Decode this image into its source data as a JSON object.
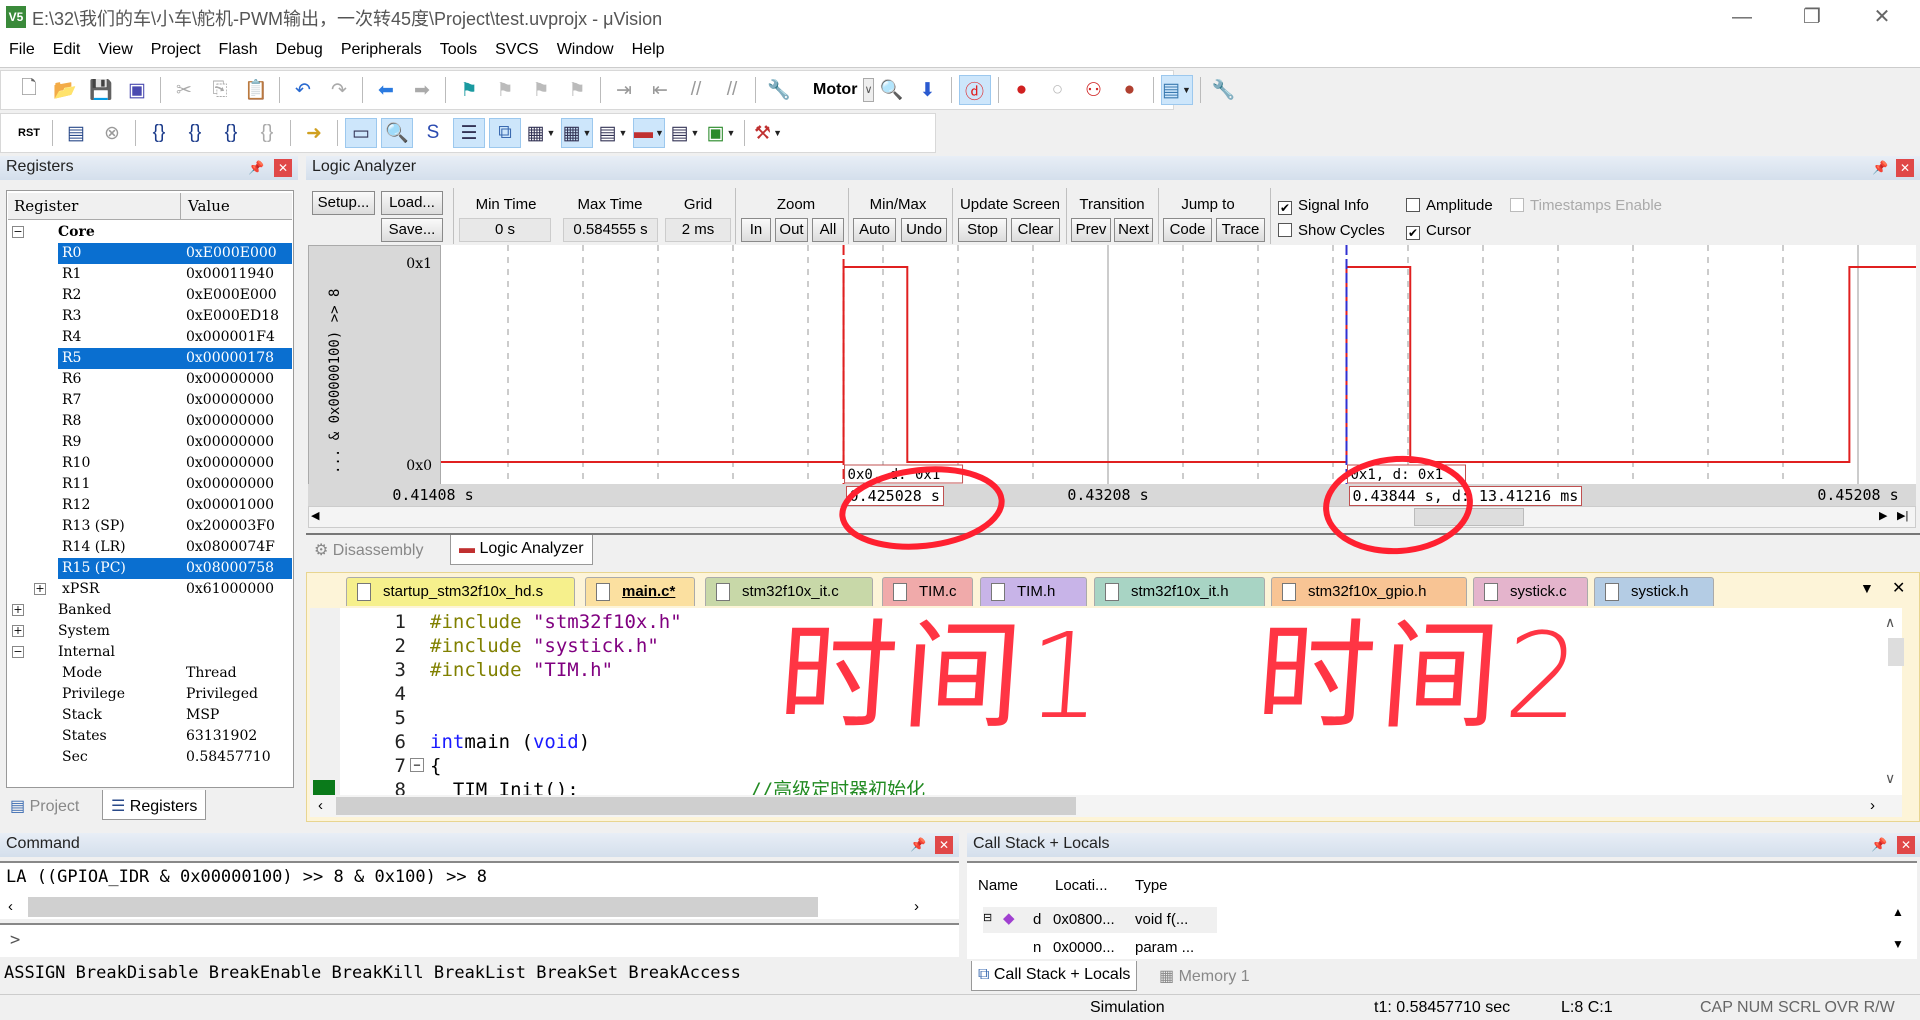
{
  "window": {
    "title": "E:\\32\\我们的车\\小车\\舵机-PWM输出，一次转45度\\Project\\test.uvprojx - μVision",
    "app_icon": "V5",
    "controls": [
      "—",
      "❐",
      "✕"
    ]
  },
  "menu": [
    "File",
    "Edit",
    "View",
    "Project",
    "Flash",
    "Debug",
    "Peripherals",
    "Tools",
    "SVCS",
    "Window",
    "Help"
  ],
  "toolbar1": {
    "left_icons": [
      {
        "name": "new-file",
        "glyph": "🗋",
        "color": "#666"
      },
      {
        "name": "open-file",
        "glyph": "📂",
        "color": "#c98a1a"
      },
      {
        "name": "save",
        "glyph": "💾",
        "color": "#2a4ea0"
      },
      {
        "name": "save-all",
        "glyph": "▣",
        "color": "#4a4ab0"
      },
      {
        "sep": true
      },
      {
        "name": "cut",
        "glyph": "✂",
        "color": "#aaa"
      },
      {
        "name": "copy",
        "glyph": "⎘",
        "color": "#aaa"
      },
      {
        "name": "paste",
        "glyph": "📋",
        "color": "#b08a30"
      },
      {
        "sep": true
      },
      {
        "name": "undo",
        "glyph": "↶",
        "color": "#2a6ad0"
      },
      {
        "name": "redo",
        "glyph": "↷",
        "color": "#aaa"
      },
      {
        "sep": true
      },
      {
        "name": "navigate-back",
        "glyph": "⬅",
        "color": "#2a7ae0"
      },
      {
        "name": "navigate-forward",
        "glyph": "➡",
        "color": "#aaa"
      },
      {
        "sep": true
      },
      {
        "name": "insert-bookmark",
        "glyph": "⚑",
        "color": "#1a9aa0"
      },
      {
        "name": "previous-bookmark",
        "glyph": "⚑",
        "color": "#bbb"
      },
      {
        "name": "next-bookmark",
        "glyph": "⚑",
        "color": "#bbb"
      },
      {
        "name": "clear-bookmarks",
        "glyph": "⚑",
        "color": "#bbb"
      },
      {
        "sep": true
      },
      {
        "name": "indent",
        "glyph": "⇥",
        "color": "#999"
      },
      {
        "name": "unindent",
        "glyph": "⇤",
        "color": "#999"
      },
      {
        "name": "comment",
        "glyph": "//",
        "color": "#999"
      },
      {
        "name": "uncomment",
        "glyph": "//",
        "color": "#999"
      },
      {
        "sep": true
      },
      {
        "name": "target-options",
        "glyph": "🔧",
        "color": "#b08a30"
      }
    ],
    "target": "Motor",
    "right_icons": [
      {
        "name": "find-in-files",
        "glyph": "🔍",
        "color": "#335"
      },
      {
        "name": "find",
        "glyph": "⬇",
        "color": "#2a5ad0"
      },
      {
        "sep": true
      },
      {
        "name": "debug-session",
        "glyph": "ⓓ",
        "color": "#e02020",
        "active": true
      },
      {
        "sep": true
      },
      {
        "name": "insert-breakpoint",
        "glyph": "●",
        "color": "#d02020"
      },
      {
        "name": "disable-breakpoint",
        "glyph": "○",
        "color": "#bbb"
      },
      {
        "name": "disable-all-breakpoints",
        "glyph": "⚇",
        "color": "#d02020"
      },
      {
        "name": "kill-all-breakpoints",
        "glyph": "●",
        "color": "#b04030"
      },
      {
        "sep": true
      },
      {
        "name": "window-layout",
        "glyph": "▤",
        "color": "#3a7ab0",
        "active": true,
        "dropdown": true
      },
      {
        "sep": true
      },
      {
        "name": "configure",
        "glyph": "🔧",
        "color": "#4a6a9a"
      }
    ]
  },
  "toolbar2": [
    {
      "name": "reset",
      "glyph": "RST",
      "color": "#000"
    },
    {
      "sep": true
    },
    {
      "name": "run",
      "glyph": "▤",
      "color": "#2a4a8a"
    },
    {
      "name": "stop",
      "glyph": "⊗",
      "color": "#999"
    },
    {
      "sep": true
    },
    {
      "name": "step-into",
      "glyph": "{}",
      "color": "#1a3a8a"
    },
    {
      "name": "step-over",
      "glyph": "{}",
      "color": "#1a3a8a"
    },
    {
      "name": "step-out",
      "glyph": "{}",
      "color": "#1a3a8a"
    },
    {
      "name": "run-to-cursor",
      "glyph": "{}",
      "color": "#aaa"
    },
    {
      "sep": true
    },
    {
      "name": "show-next-statement",
      "glyph": "➜",
      "color": "#d0a020"
    },
    {
      "sep": true
    },
    {
      "name": "command-window",
      "glyph": "▭",
      "color": "#335",
      "active": true
    },
    {
      "name": "disassembly-window",
      "glyph": "🔍",
      "color": "#335",
      "active": true
    },
    {
      "name": "symbols-window",
      "glyph": "S",
      "color": "#2a4ab0"
    },
    {
      "name": "registers-window",
      "glyph": "☰",
      "color": "#335",
      "active": true
    },
    {
      "name": "call-stack-window",
      "glyph": "⧉",
      "color": "#3a6ab0",
      "active": true
    },
    {
      "name": "watch-window",
      "glyph": "▦",
      "color": "#335",
      "dropdown": true
    },
    {
      "name": "memory-window",
      "glyph": "▦",
      "color": "#335",
      "active": true,
      "dropdown": true
    },
    {
      "name": "serial-window",
      "glyph": "▤",
      "color": "#335",
      "dropdown": true
    },
    {
      "name": "analysis-window",
      "glyph": "▬",
      "color": "#c03030",
      "active": true,
      "dropdown": true
    },
    {
      "name": "trace-window",
      "glyph": "▤",
      "color": "#335",
      "dropdown": true
    },
    {
      "name": "system-viewer",
      "glyph": "▣",
      "color": "#2a8a2a",
      "dropdown": true
    },
    {
      "sep": true
    },
    {
      "name": "toolbox",
      "glyph": "⚒",
      "color": "#c03030",
      "dropdown": true
    }
  ],
  "registers_panel": {
    "title": "Registers",
    "columns": [
      "Register",
      "Value"
    ],
    "rows": [
      {
        "name": "Core",
        "value": "",
        "level": 0,
        "expander": "−",
        "bold": true
      },
      {
        "name": "R0",
        "value": "0xE000E000",
        "level": 1,
        "selected": true
      },
      {
        "name": "R1",
        "value": "0x00011940",
        "level": 1
      },
      {
        "name": "R2",
        "value": "0xE000E000",
        "level": 1
      },
      {
        "name": "R3",
        "value": "0xE000ED18",
        "level": 1
      },
      {
        "name": "R4",
        "value": "0x000001F4",
        "level": 1
      },
      {
        "name": "R5",
        "value": "0x00000178",
        "level": 1,
        "selected": true
      },
      {
        "name": "R6",
        "value": "0x00000000",
        "level": 1
      },
      {
        "name": "R7",
        "value": "0x00000000",
        "level": 1
      },
      {
        "name": "R8",
        "value": "0x00000000",
        "level": 1
      },
      {
        "name": "R9",
        "value": "0x00000000",
        "level": 1
      },
      {
        "name": "R10",
        "value": "0x00000000",
        "level": 1
      },
      {
        "name": "R11",
        "value": "0x00000000",
        "level": 1
      },
      {
        "name": "R12",
        "value": "0x00001000",
        "level": 1
      },
      {
        "name": "R13 (SP)",
        "value": "0x200003F0",
        "level": 1
      },
      {
        "name": "R14 (LR)",
        "value": "0x0800074F",
        "level": 1
      },
      {
        "name": "R15 (PC)",
        "value": "0x08000758",
        "level": 1,
        "selected": true
      },
      {
        "name": "xPSR",
        "value": "0x61000000",
        "level": 1,
        "expander": "+"
      },
      {
        "name": "Banked",
        "value": "",
        "level": 0,
        "expander": "+"
      },
      {
        "name": "System",
        "value": "",
        "level": 0,
        "expander": "+"
      },
      {
        "name": "Internal",
        "value": "",
        "level": 0,
        "expander": "−"
      },
      {
        "name": "Mode",
        "value": "Thread",
        "level": 1
      },
      {
        "name": "Privilege",
        "value": "Privileged",
        "level": 1
      },
      {
        "name": "Stack",
        "value": "MSP",
        "level": 1
      },
      {
        "name": "States",
        "value": "63131902",
        "level": 1
      },
      {
        "name": "Sec",
        "value": "0.58457710",
        "level": 1
      }
    ],
    "tabs": [
      "Project",
      "Registers"
    ],
    "active_tab": "Registers"
  },
  "logic_analyzer": {
    "title": "Logic Analyzer",
    "buttons": {
      "setup": "Setup...",
      "load": "Load...",
      "save": "Save..."
    },
    "min_time": {
      "label": "Min Time",
      "value": "0 s"
    },
    "max_time": {
      "label": "Max Time",
      "value": "0.584555 s"
    },
    "grid": {
      "label": "Grid",
      "value": "2 ms"
    },
    "zoom": {
      "label": "Zoom",
      "in": "In",
      "out": "Out",
      "all": "All"
    },
    "minmax": {
      "label": "Min/Max",
      "auto": "Auto",
      "undo": "Undo"
    },
    "update_screen": {
      "label": "Update Screen",
      "stop": "Stop",
      "clear": "Clear"
    },
    "transition": {
      "label": "Transition",
      "prev": "Prev",
      "next": "Next"
    },
    "jump_to": {
      "label": "Jump to",
      "code": "Code",
      "trace": "Trace"
    },
    "options": {
      "signal_info": {
        "label": "Signal Info",
        "checked": true
      },
      "amplitude": {
        "label": "Amplitude",
        "checked": false
      },
      "timestamps_enable": {
        "label": "Timestamps Enable",
        "checked": false,
        "disabled": true
      },
      "show_cycles": {
        "label": "Show Cycles",
        "checked": false
      },
      "cursor": {
        "label": "Cursor",
        "checked": true
      }
    },
    "signal": {
      "label": "... & 0x00000100) >> 8",
      "y_high": "0x1",
      "y_low": "0x0",
      "color": "#e02020",
      "grid_ms": 2,
      "view_start_s": 0.41408,
      "initial_level": 0,
      "transitions_s": [
        0.425028,
        0.426728,
        0.43844,
        0.44014,
        0.45185
      ]
    },
    "time_ticks": [
      {
        "t": 0.41408,
        "label": "0.41408 s"
      },
      {
        "t": 0.43208,
        "label": "0.43208 s"
      },
      {
        "t": 0.45208,
        "label": "0.45208 s"
      }
    ],
    "cursor1": {
      "t": 0.425028,
      "time_label": "0.425028 s",
      "value_label": "0x0, d: 0x1",
      "color": "#e02020"
    },
    "cursor2": {
      "t": 0.43844,
      "time_label": "0.43844 s, d: 13.41216 ms",
      "value_label": "0x1, d: 0x1",
      "color": "#3030d0"
    },
    "bottom_tabs": [
      "Disassembly",
      "Logic Analyzer"
    ],
    "active_tab": "Logic Analyzer"
  },
  "editor": {
    "tabs": [
      {
        "label": "startup_stm32f10x_hd.s",
        "color": "#f6f08c"
      },
      {
        "label": "main.c*",
        "color": "#fbe0a0",
        "active": true
      },
      {
        "label": "stm32f10x_it.c",
        "color": "#c8d8a8"
      },
      {
        "label": "TIM.c",
        "color": "#f0aaaa"
      },
      {
        "label": "TIM.h",
        "color": "#c8b4e8"
      },
      {
        "label": "stm32f10x_it.h",
        "color": "#a8d4c4"
      },
      {
        "label": "stm32f10x_gpio.h",
        "color": "#f8c494"
      },
      {
        "label": "systick.c",
        "color": "#e4b4cc"
      },
      {
        "label": "systick.h",
        "color": "#b4cce4"
      }
    ],
    "lines": [
      {
        "n": "1",
        "parts": [
          [
            "pp",
            "#include "
          ],
          [
            "str",
            "\"stm32f10x.h\""
          ]
        ]
      },
      {
        "n": "2",
        "parts": [
          [
            "pp",
            "#include "
          ],
          [
            "str",
            "\"systick.h\""
          ]
        ]
      },
      {
        "n": "3",
        "parts": [
          [
            "pp",
            "#include "
          ],
          [
            "str",
            "\"TIM.h\""
          ]
        ]
      },
      {
        "n": "4",
        "parts": []
      },
      {
        "n": "5",
        "parts": []
      },
      {
        "n": "6",
        "parts": [
          [
            "kw",
            "int"
          ],
          [
            "",
            "main ("
          ],
          [
            "kw",
            "void"
          ],
          [
            "",
            ")"
          ]
        ]
      },
      {
        "n": "7",
        "parts": [
          [
            "",
            "{"
          ]
        ]
      },
      {
        "n": "8",
        "parts": [
          [
            "",
            "  TIM_Init();               "
          ],
          [
            "cm",
            "//高级定时器初始化"
          ]
        ]
      }
    ]
  },
  "annotations": {
    "note1": "时间1",
    "note2": "时间2",
    "color": "#ff2030"
  },
  "command": {
    "title": "Command",
    "output": "LA ((GPIOA_IDR & 0x00000100) >> 8 & 0x100) >> 8",
    "prompt": ">",
    "input_value": "",
    "help": "ASSIGN BreakDisable BreakEnable BreakKill BreakList BreakSet BreakAccess"
  },
  "call_stack": {
    "title": "Call Stack + Locals",
    "columns": [
      "Name",
      "Locati...",
      "Type"
    ],
    "rows": [
      {
        "name": "d",
        "location": "0x0800...",
        "type": "void f(..."
      },
      {
        "name": "n",
        "location": "0x0000...",
        "type": "param ..."
      }
    ],
    "tabs": [
      "Call Stack + Locals",
      "Memory 1"
    ],
    "active_tab": "Call Stack + Locals"
  },
  "status": {
    "mode": "Simulation",
    "time": "t1: 0.58457710 sec",
    "position": "L:8 C:1",
    "indicators": "CAP NUM SCRL OVR R/W"
  }
}
